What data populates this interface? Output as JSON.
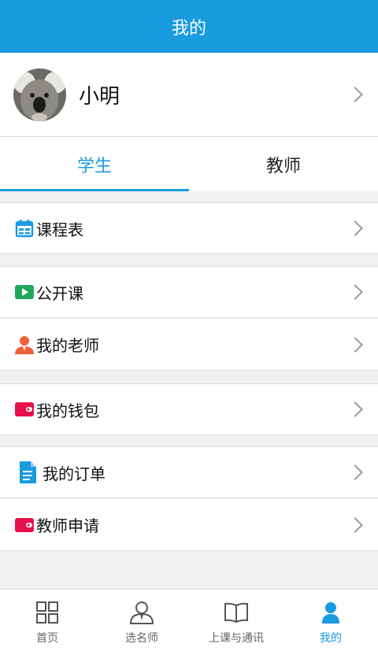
{
  "header": {
    "title": "我的"
  },
  "profile": {
    "name": "小明"
  },
  "tabs": [
    {
      "label": "学生",
      "active": true
    },
    {
      "label": "教师",
      "active": false
    }
  ],
  "menu": {
    "schedule": {
      "label": "课程表",
      "icon": "calendar-icon"
    },
    "open_course": {
      "label": "公开课",
      "icon": "play-icon"
    },
    "my_teacher": {
      "label": "我的老师",
      "icon": "person-icon"
    },
    "wallet": {
      "label": "我的钱包",
      "icon": "wallet-icon"
    },
    "orders": {
      "label": "我的订单",
      "icon": "document-icon"
    },
    "teacher_apply": {
      "label": "教师申请",
      "icon": "wallet-icon"
    }
  },
  "bottom_nav": [
    {
      "label": "首页",
      "icon": "grid-icon",
      "active": false
    },
    {
      "label": "选名师",
      "icon": "teacher-icon",
      "active": false
    },
    {
      "label": "上课与通讯",
      "icon": "book-icon",
      "active": false
    },
    {
      "label": "我的",
      "icon": "user-icon",
      "active": true
    }
  ],
  "colors": {
    "accent": "#1a9be0",
    "wallet_red": "#e8104a",
    "person_orange": "#f0603a",
    "play_green": "#1eaa5a"
  }
}
